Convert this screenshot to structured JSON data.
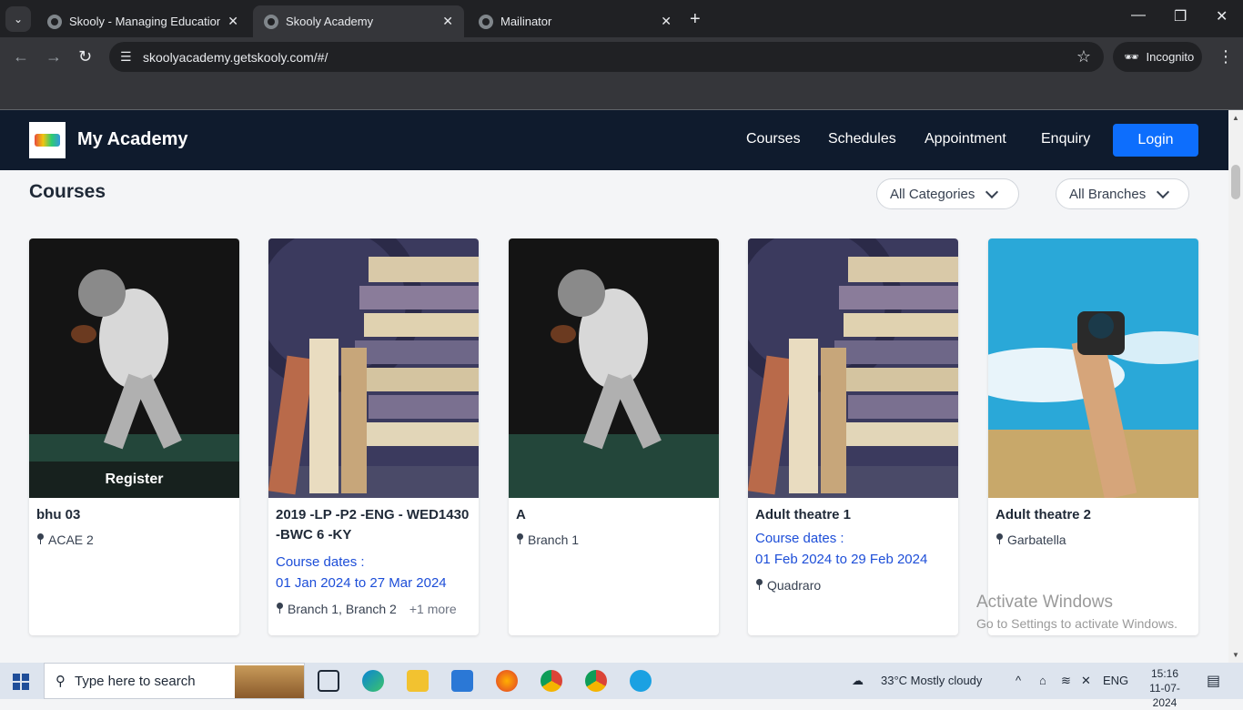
{
  "browser": {
    "tabs": [
      {
        "title": "Skooly - Managing Educational",
        "active": false
      },
      {
        "title": "Skooly Academy",
        "active": true
      },
      {
        "title": "Mailinator",
        "active": false
      }
    ],
    "url": "skoolyacademy.getskooly.com/#/",
    "incognito_label": "Incognito"
  },
  "header": {
    "brand": "My Academy",
    "nav": [
      "Courses",
      "Schedules",
      "Appointment",
      "Enquiry"
    ],
    "login_label": "Login"
  },
  "main": {
    "title": "Courses",
    "filters": {
      "categories": "All Categories",
      "branches": "All Branches"
    },
    "cards": [
      {
        "title": "bhu 03",
        "branch": "ACAE 2",
        "image": "football-player",
        "overlay": "Register"
      },
      {
        "title": "2019 -LP -P2 -ENG - WED1430 -BWC 6 -KY",
        "dates_label": "Course dates :",
        "dates": "01 Jan 2024 to 27 Mar 2024",
        "branch": "Branch 1, Branch 2",
        "more": "+1 more",
        "image": "books"
      },
      {
        "title": "A",
        "branch": "Branch 1",
        "image": "football-player"
      },
      {
        "title": "Adult theatre 1",
        "dates_label": "Course dates :",
        "dates": "01 Feb 2024 to 29 Feb 2024",
        "branch": "Quadraro",
        "image": "books"
      },
      {
        "title": "Adult theatre 2",
        "branch": "Garbatella",
        "image": "camera-sky"
      }
    ]
  },
  "watermark": {
    "line1": "Activate Windows",
    "line2": "Go to Settings to activate Windows."
  },
  "taskbar": {
    "search_placeholder": "Type here to search",
    "weather": "33°C  Mostly cloudy",
    "lang": "ENG",
    "time": "15:16",
    "date": "11-07-2024"
  },
  "colors": {
    "header_bg": "#0f1b2d",
    "login_btn": "#0d6efd",
    "dates_text": "#1d4ed8"
  }
}
